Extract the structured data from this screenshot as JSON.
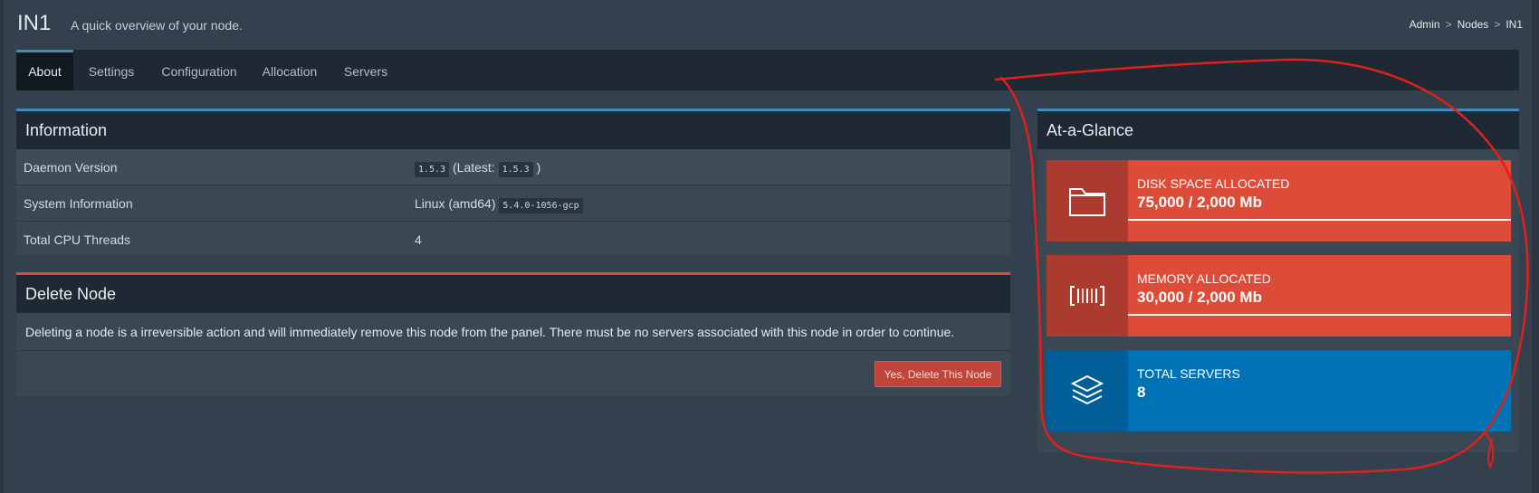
{
  "header": {
    "title": "IN1",
    "subtitle": "A quick overview of your node.",
    "breadcrumb": [
      "Admin",
      "Nodes",
      "IN1"
    ]
  },
  "tabs": [
    {
      "label": "About",
      "active": true
    },
    {
      "label": "Settings",
      "active": false
    },
    {
      "label": "Configuration",
      "active": false
    },
    {
      "label": "Allocation",
      "active": false
    },
    {
      "label": "Servers",
      "active": false
    }
  ],
  "information": {
    "title": "Information",
    "rows": [
      {
        "key": "Daemon Version",
        "version": "1.5.3",
        "latest_prefix": "(Latest:",
        "latest": "1.5.3",
        "latest_suffix": ")"
      },
      {
        "key": "System Information",
        "os": "Linux (amd64)",
        "kernel": "5.4.0-1056-gcp"
      },
      {
        "key": "Total CPU Threads",
        "value": "4"
      }
    ]
  },
  "delete_node": {
    "title": "Delete Node",
    "text": "Deleting a node is a irreversible action and will immediately remove this node from the panel. There must be no servers associated with this node in order to continue.",
    "button": "Yes, Delete This Node"
  },
  "glance": {
    "title": "At-a-Glance",
    "stats": [
      {
        "label": "DISK SPACE ALLOCATED",
        "value": "75,000 / 2,000 Mb",
        "icon": "folder-icon",
        "color": "#dd4b39",
        "progress": 1.0
      },
      {
        "label": "MEMORY ALLOCATED",
        "value": "30,000 / 2,000 Mb",
        "icon": "barcode-icon",
        "color": "#dd4b39",
        "progress": 1.0
      },
      {
        "label": "TOTAL SERVERS",
        "value": "8",
        "icon": "layers-icon",
        "color": "#0073b7"
      }
    ]
  },
  "colors": {
    "accent": "#3c8dbc",
    "danger": "#dd4b39",
    "info": "#0073b7",
    "annotation": "#e0201c"
  }
}
